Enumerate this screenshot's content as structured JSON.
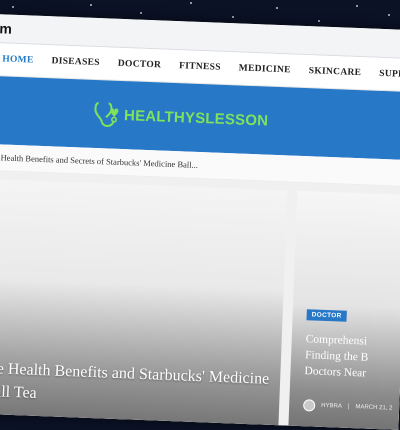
{
  "browser": {
    "url_fragment": "m"
  },
  "nav": {
    "items": [
      {
        "label": "HOME",
        "active": true
      },
      {
        "label": "DISEASES"
      },
      {
        "label": "DOCTOR"
      },
      {
        "label": "FITNESS"
      },
      {
        "label": "MEDICINE"
      },
      {
        "label": "SKINCARE"
      },
      {
        "label": "SUPPLEMENTS"
      }
    ]
  },
  "brand": {
    "name": "HEALTHYSLESSON",
    "logo_icon": "stethoscope-heart-icon"
  },
  "breadcrumb": {
    "text": "he Health Benefits and Secrets of Starbucks' Medicine Ball..."
  },
  "hero": {
    "title": "the Health Benefits and Starbucks' Medicine Ball Tea"
  },
  "side_post": {
    "category": "DOCTOR",
    "title": "Comprehensi Finding the B Doctors Near",
    "author": "HYBRA",
    "date": "MARCH 21, 2"
  },
  "colors": {
    "accent": "#2878c8",
    "brand_green": "#7ee35a",
    "active_nav": "#1f7bc8",
    "background": "#0b1226"
  }
}
